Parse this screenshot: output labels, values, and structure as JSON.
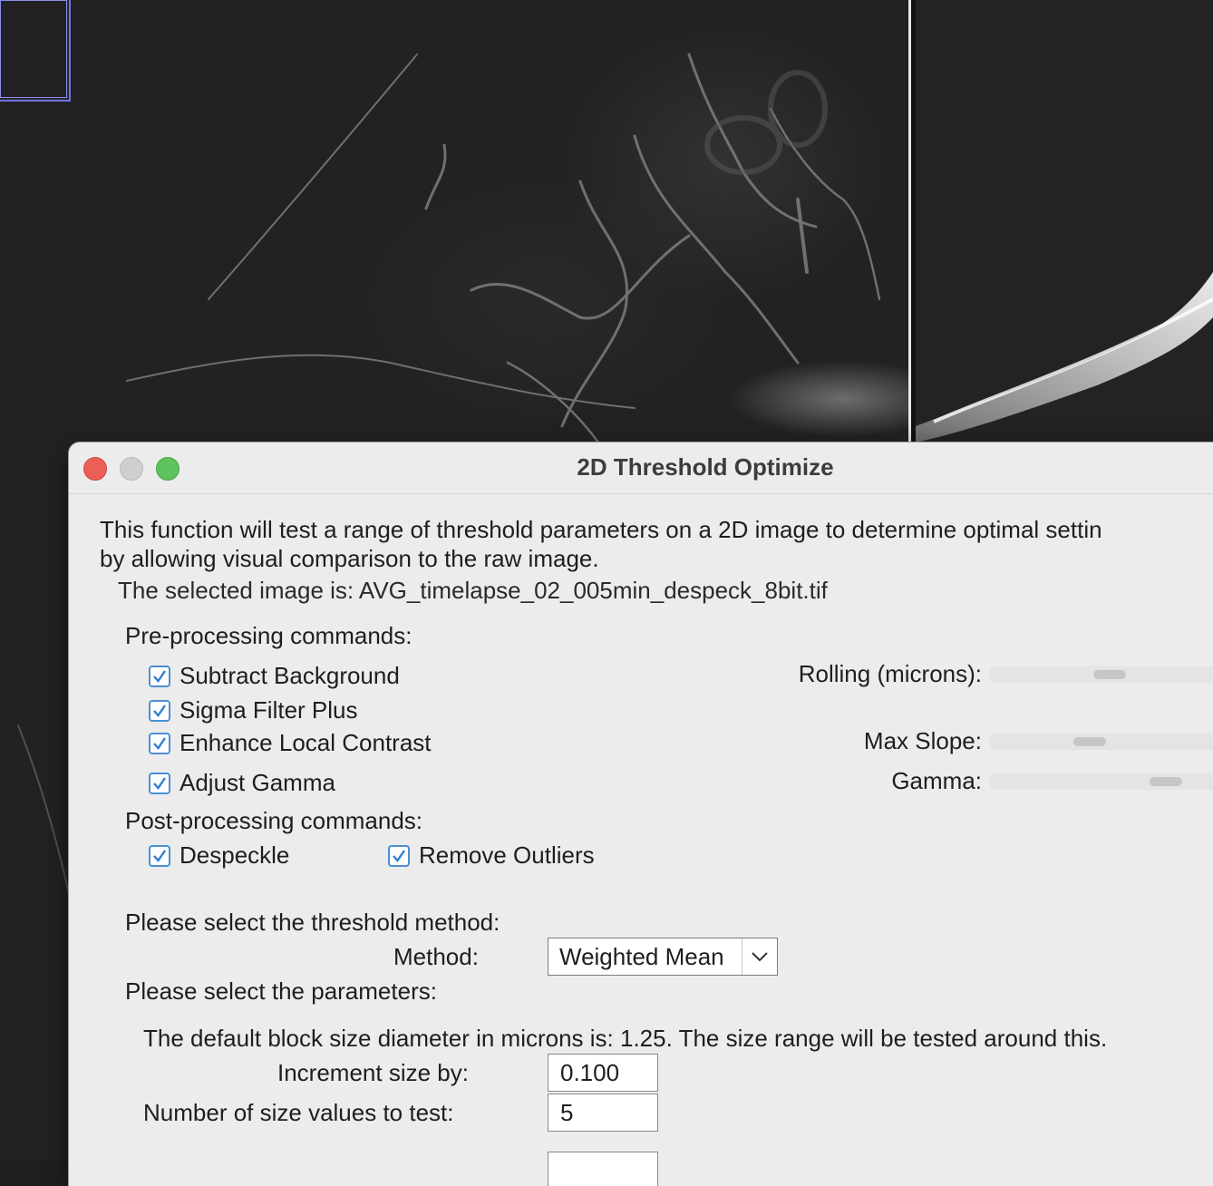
{
  "dialog": {
    "title": "2D Threshold Optimize",
    "intro_line1": "This function will test a range of threshold parameters on a 2D image to determine optimal settin",
    "intro_line2": "by allowing visual comparison to the raw image.",
    "selected_image": "The selected image is: AVG_timelapse_02_005min_despeck_8bit.tif",
    "preprocessing_heading": "Pre-processing commands:",
    "preprocessing": [
      {
        "label": "Subtract Background",
        "checked": true
      },
      {
        "label": "Sigma Filter Plus",
        "checked": true
      },
      {
        "label": "Enhance Local Contrast",
        "checked": true
      },
      {
        "label": "Adjust Gamma",
        "checked": true
      }
    ],
    "sliders": {
      "rolling_label": "Rolling (microns):",
      "max_slope_label": "Max Slope:",
      "gamma_label": "Gamma:"
    },
    "postprocessing_heading": "Post-processing commands:",
    "postprocessing": [
      {
        "label": "Despeckle",
        "checked": true
      },
      {
        "label": "Remove Outliers",
        "checked": true
      }
    ],
    "threshold_heading": "Please select the threshold method:",
    "method_label": "Method:",
    "method_value": "Weighted Mean",
    "parameters_heading": "Please select the parameters:",
    "block_size_text": "The default block size diameter in microns is:  1.25. The size range will be tested around this.",
    "increment_label": "Increment size by:",
    "increment_value": "0.100",
    "num_values_label": "Number of size values to test:",
    "num_values_value": "5"
  }
}
